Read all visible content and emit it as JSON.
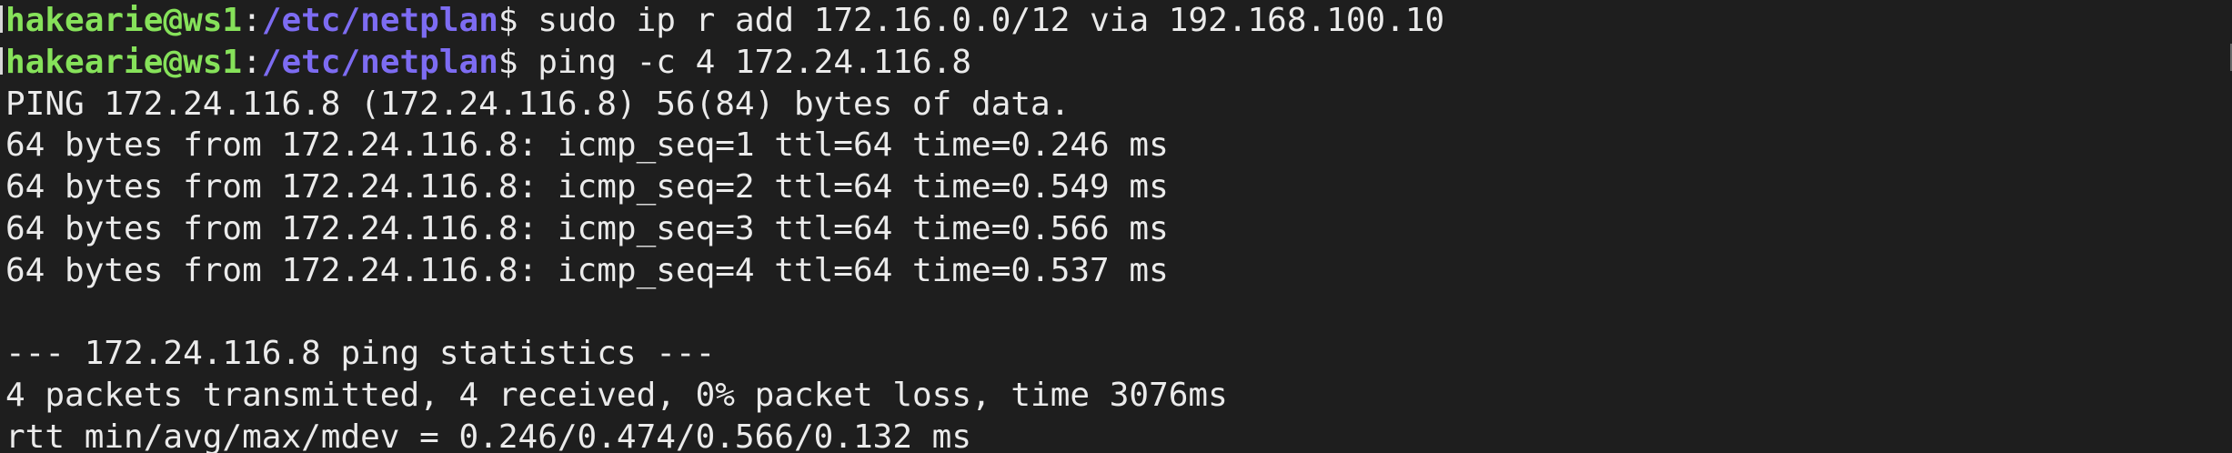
{
  "prompt": {
    "user_host": "hakearie@ws1",
    "colon": ":",
    "path": "/etc/netplan",
    "dollar": "$"
  },
  "commands": [
    " sudo ip r add 172.16.0.0/12 via 192.168.100.10",
    " ping -c 4 172.24.116.8"
  ],
  "output": [
    "PING 172.24.116.8 (172.24.116.8) 56(84) bytes of data.",
    "64 bytes from 172.24.116.8: icmp_seq=1 ttl=64 time=0.246 ms",
    "64 bytes from 172.24.116.8: icmp_seq=2 ttl=64 time=0.549 ms",
    "64 bytes from 172.24.116.8: icmp_seq=3 ttl=64 time=0.566 ms",
    "64 bytes from 172.24.116.8: icmp_seq=4 ttl=64 time=0.537 ms",
    "",
    "--- 172.24.116.8 ping statistics ---",
    "4 packets transmitted, 4 received, 0% packet loss, time 3076ms",
    "rtt min/avg/max/mdev = 0.246/0.474/0.566/0.132 ms"
  ],
  "colors": {
    "background": "#1e1e1e",
    "text": "#ebebeb",
    "user_host": "#86e25a",
    "path": "#7d6cf2"
  }
}
